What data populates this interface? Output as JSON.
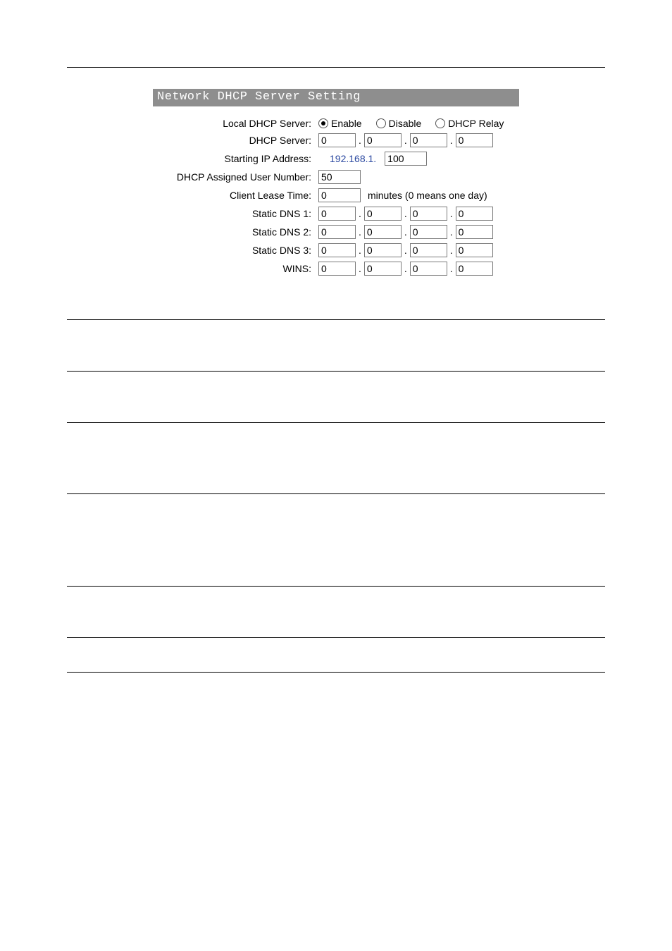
{
  "panel": {
    "title": "Network DHCP Server Setting",
    "rows": {
      "local_dhcp_server": {
        "label": "Local DHCP Server:",
        "options": {
          "enable": "Enable",
          "disable": "Disable",
          "relay": "DHCP Relay"
        },
        "selected": "enable"
      },
      "dhcp_server": {
        "label": "DHCP Server:",
        "ip": [
          "0",
          "0",
          "0",
          "0"
        ]
      },
      "starting_ip": {
        "label": "Starting IP Address:",
        "prefix": "192.168.1.",
        "value": "100"
      },
      "user_number": {
        "label": "DHCP Assigned User Number:",
        "value": "50"
      },
      "client_lease": {
        "label": "Client Lease Time:",
        "value": "0",
        "suffix": "minutes (0 means one day)"
      },
      "dns1": {
        "label": "Static DNS 1:",
        "ip": [
          "0",
          "0",
          "0",
          "0"
        ]
      },
      "dns2": {
        "label": "Static DNS 2:",
        "ip": [
          "0",
          "0",
          "0",
          "0"
        ]
      },
      "dns3": {
        "label": "Static DNS 3:",
        "ip": [
          "0",
          "0",
          "0",
          "0"
        ]
      },
      "wins": {
        "label": "WINS:",
        "ip": [
          "0",
          "0",
          "0",
          "0"
        ]
      }
    }
  },
  "defs": [
    {
      "h": "normal"
    },
    {
      "h": "normal"
    },
    {
      "h": "wide"
    },
    {
      "h": "wider"
    },
    {
      "h": "normal"
    },
    {
      "h": "normal"
    }
  ]
}
